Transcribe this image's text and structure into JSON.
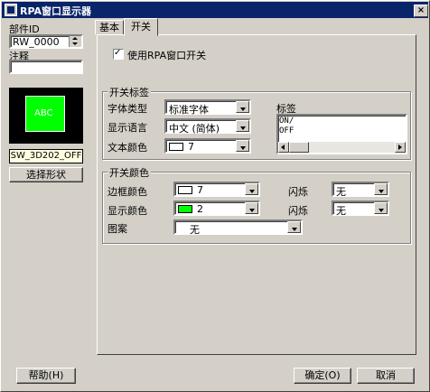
{
  "window": {
    "title": "RPA窗口显示器",
    "close_glyph": "×"
  },
  "left": {
    "part_id_label": "部件ID",
    "part_id_value": "RW_0000",
    "comment_label": "注释",
    "comment_value": "",
    "preview_text": "ABC",
    "preview_color": "#00ff00",
    "preview_name": "SW_3D202_OFF",
    "select_shape_label": "选择形状"
  },
  "tabs": [
    {
      "label": "基本"
    },
    {
      "label": "开关"
    }
  ],
  "switch_tab": {
    "use_switch_label": "使用RPA窗口开关",
    "use_switch_checked": true,
    "label_group": {
      "title": "开关标签",
      "font_type_label": "字体类型",
      "font_type_value": "标准字体",
      "language_label": "显示语言",
      "language_value": "中文 (简体)",
      "text_color_label": "文本颜色",
      "text_color_value": "7",
      "text_color_swatch": "#ffffff",
      "tag_label": "标签",
      "tag_lines": [
        "ON/",
        "OFF"
      ]
    },
    "color_group": {
      "title": "开关颜色",
      "border_color_label": "边框颜色",
      "border_color_value": "7",
      "border_color_swatch": "#ffffff",
      "blink1_label": "闪烁",
      "blink1_value": "无",
      "display_color_label": "显示颜色",
      "display_color_value": "2",
      "display_color_swatch": "#00ff00",
      "blink2_label": "闪烁",
      "blink2_value": "无",
      "pattern_label": "图案",
      "pattern_value": "无"
    }
  },
  "footer": {
    "help_label": "帮助(H)",
    "ok_label": "确定(O)",
    "cancel_label": "取消"
  }
}
